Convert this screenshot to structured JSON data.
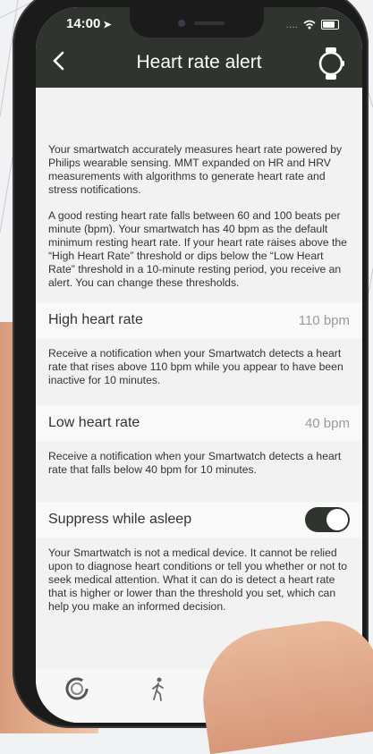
{
  "status": {
    "time": "14:00",
    "signal": "....",
    "wifi": "wifi-icon",
    "battery": "battery-icon"
  },
  "header": {
    "title": "Heart rate alert",
    "back_icon": "chevron-left-icon",
    "watch_icon": "watch-icon"
  },
  "intro": {
    "p1": "Your smartwatch accurately measures heart rate powered by Philips wearable sensing. MMT expanded on HR  and HRV measurements with algorithms to generate heart rate and stress notifications.",
    "p2": "A good resting heart rate falls between 60 and 100 beats per minute (bpm). Your smartwatch has 40 bpm as the default minimum resting heart rate. If your heart rate raises above the “High Heart Rate” threshold or dips below the “Low Heart Rate” threshold in a 10-minute resting period, you receive an alert. You can change these thresholds."
  },
  "high": {
    "label": "High heart rate",
    "value": "110 bpm",
    "desc": "Receive a notification when your Smartwatch detects a heart rate that rises above 110 bpm while you appear to have been inactive for 10 minutes."
  },
  "low": {
    "label": "Low heart rate",
    "value": "40 bpm",
    "desc": "Receive a notification when your Smartwatch detects a heart rate that falls below 40 bpm for 10 minutes."
  },
  "suppress": {
    "label": "Suppress while asleep",
    "enabled": true,
    "desc": "Your Smartwatch is not a medical device. It cannot be relied upon to diagnose heart conditions or tell you whether or not to seek medical attention. What it can do is detect a heart rate that is higher or lower than the threshold you set, which can help you make an informed decision."
  },
  "tabs": [
    {
      "icon": "activity-ring-icon"
    },
    {
      "icon": "walking-icon"
    },
    {
      "icon": "heart-icon"
    },
    {
      "icon": "moon-icon"
    }
  ],
  "colors": {
    "header": "#2f342f",
    "toggle_on": "#2f342f",
    "value_gray": "#9a9a9a"
  }
}
